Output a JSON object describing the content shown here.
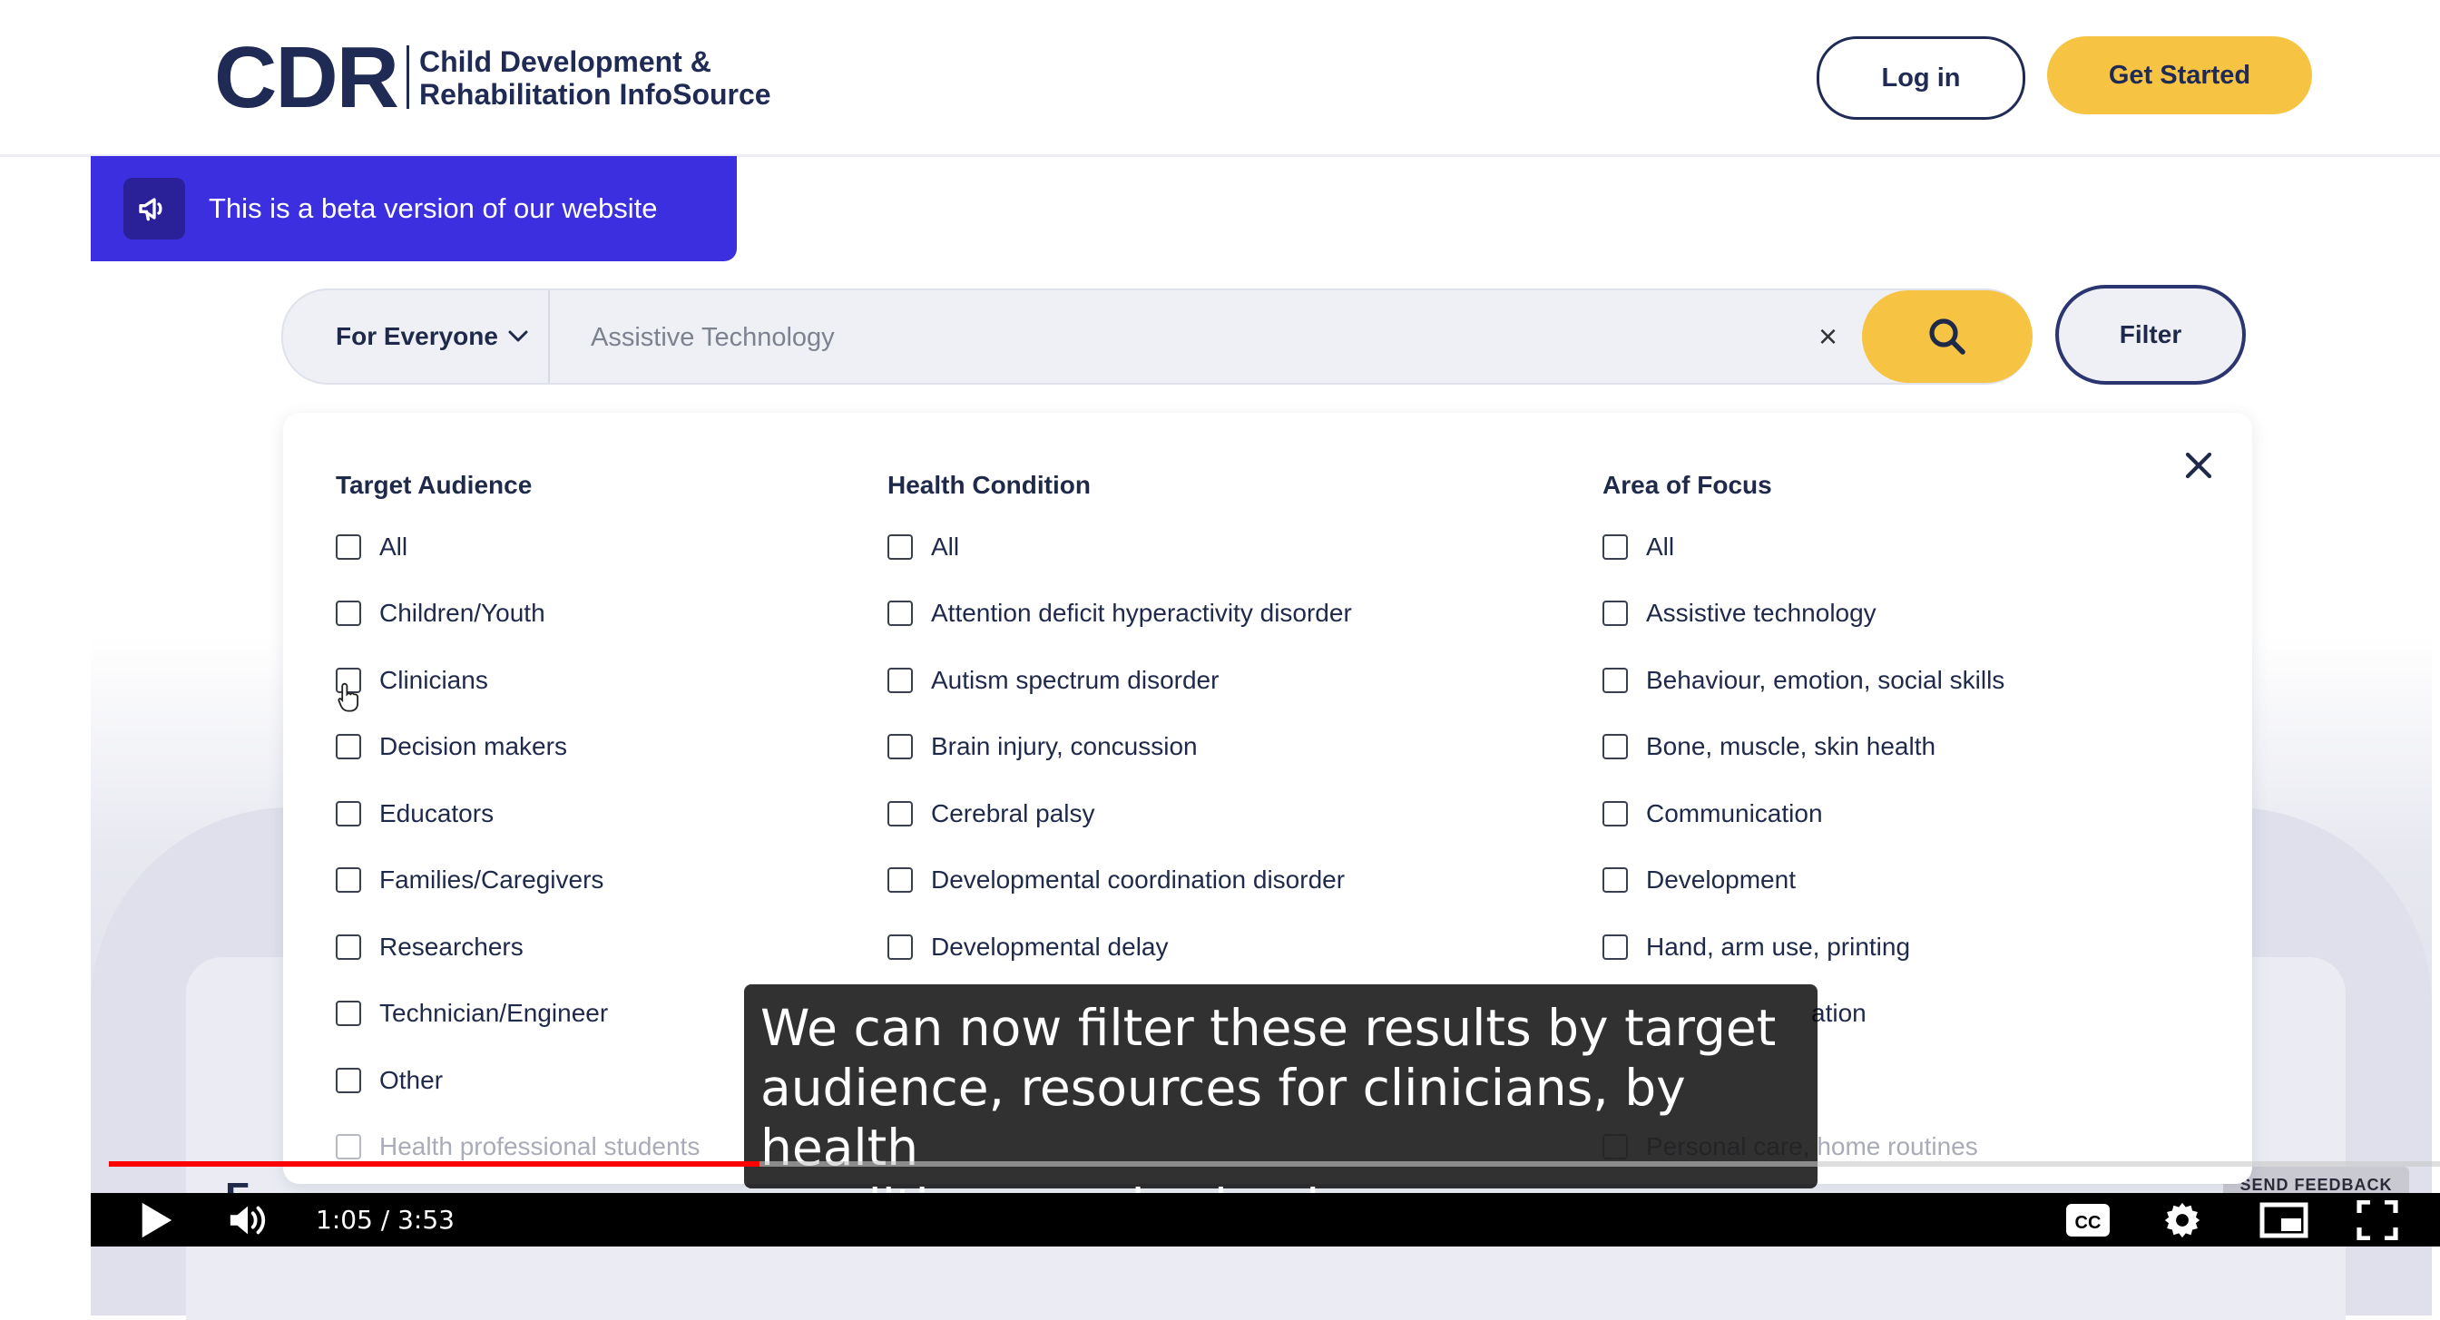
{
  "header": {
    "logo_mark": "CDR",
    "logo_line1": "Child Development &",
    "logo_line2": "Rehabilitation InfoSource",
    "login_label": "Log in",
    "get_started_label": "Get Started"
  },
  "banner": {
    "text": "This is a beta version of our website"
  },
  "search": {
    "audience_selected": "For Everyone",
    "placeholder": "Assistive Technology",
    "value": "",
    "clear_label": "×",
    "filter_label": "Filter"
  },
  "filters": {
    "target_audience": {
      "title": "Target Audience",
      "options": [
        "All",
        "Children/Youth",
        "Clinicians",
        "Decision makers",
        "Educators",
        "Families/Caregivers",
        "Researchers",
        "Technician/Engineer",
        "Other",
        "Health professional students"
      ]
    },
    "health_condition": {
      "title": "Health Condition",
      "options": [
        "All",
        "Attention deficit hyperactivity disorder",
        "Autism spectrum disorder",
        "Brain injury, concussion",
        "Cerebral palsy",
        "Developmental coordination disorder",
        "Developmental delay"
      ]
    },
    "area_of_focus": {
      "title": "Area of Focus",
      "options": [
        "All",
        "Assistive technology",
        "Behaviour, emotion, social skills",
        "Bone, muscle, skin health",
        "Communication",
        "Development",
        "Hand, arm use, printing"
      ],
      "partial": [
        "ation",
        "Personal care, home routines"
      ]
    }
  },
  "caption": {
    "line1": "We can now filter these results by target",
    "line2": "audience, resources for clinicians, by health",
    "line3": "condition, cerebral palsy,"
  },
  "player": {
    "time": "1:05 / 3:53",
    "progress_fraction": 0.279,
    "progress_color": "#ff0000"
  },
  "background": {
    "section_text": "F",
    "feedback_label": "SEND FEEDBACK"
  },
  "colors": {
    "brand_navy": "#1f2a55",
    "accent_yellow": "#f6c343",
    "banner_purple": "#3b2fe0"
  },
  "icons": [
    "megaphone-icon",
    "chevron-down-icon",
    "close-icon",
    "search-icon",
    "play-icon",
    "volume-icon",
    "captions-icon",
    "settings-icon",
    "miniplayer-icon",
    "fullscreen-icon",
    "pointer-hand-icon"
  ]
}
